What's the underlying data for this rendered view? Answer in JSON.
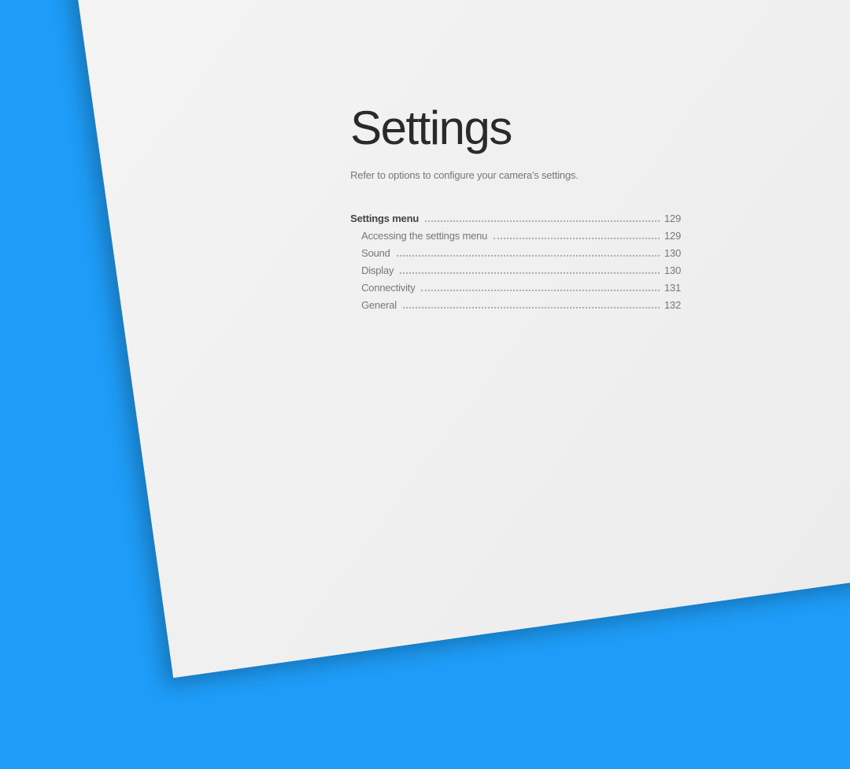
{
  "title": "Settings",
  "subtitle": "Refer to options to configure your camera's settings.",
  "toc": {
    "section": {
      "label": "Settings menu",
      "page": "129"
    },
    "items": [
      {
        "label": "Accessing the settings menu",
        "page": "129"
      },
      {
        "label": "Sound",
        "page": "130"
      },
      {
        "label": "Display",
        "page": "130"
      },
      {
        "label": "Connectivity",
        "page": "131"
      },
      {
        "label": "General",
        "page": "132"
      }
    ]
  }
}
